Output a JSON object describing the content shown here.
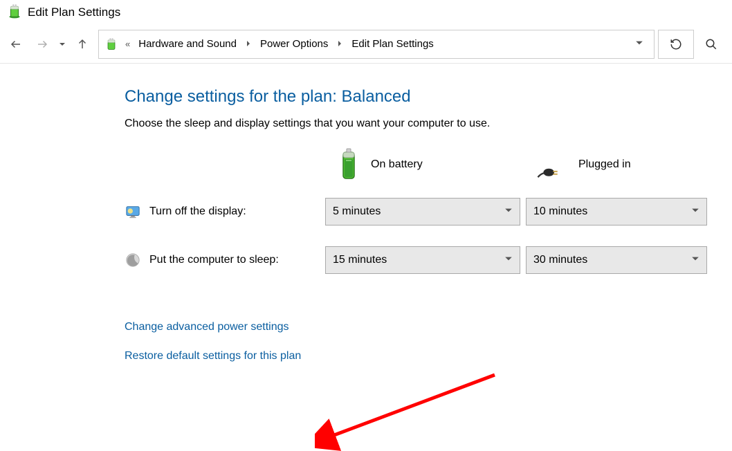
{
  "window": {
    "title": "Edit Plan Settings"
  },
  "breadcrumb": {
    "items": [
      "Hardware and Sound",
      "Power Options",
      "Edit Plan Settings"
    ]
  },
  "page": {
    "heading": "Change settings for the plan: Balanced",
    "subtext": "Choose the sleep and display settings that you want your computer to use."
  },
  "columns": {
    "battery": {
      "label": "On battery"
    },
    "plugged": {
      "label": "Plugged in"
    }
  },
  "rows": {
    "display": {
      "label": "Turn off the display:",
      "battery_value": "5 minutes",
      "plugged_value": "10 minutes"
    },
    "sleep": {
      "label": "Put the computer to sleep:",
      "battery_value": "15 minutes",
      "plugged_value": "30 minutes"
    }
  },
  "links": {
    "advanced": "Change advanced power settings",
    "restore": "Restore default settings for this plan"
  }
}
